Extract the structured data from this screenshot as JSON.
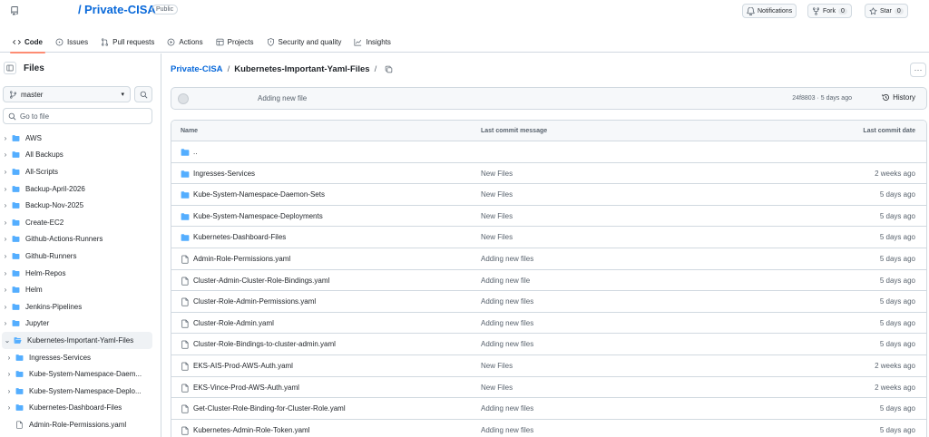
{
  "header": {
    "repo_name": "Private-CISA",
    "repo_slash": "/",
    "visibility": "Public",
    "notifications_label": "Notifications",
    "fork_label": "Fork",
    "fork_count": "0",
    "star_label": "Star",
    "star_count": "0"
  },
  "tabs": [
    {
      "label": "Code",
      "icon": "code-icon"
    },
    {
      "label": "Issues",
      "icon": "issue-icon"
    },
    {
      "label": "Pull requests",
      "icon": "pull-request-icon"
    },
    {
      "label": "Actions",
      "icon": "play-icon"
    },
    {
      "label": "Projects",
      "icon": "table-icon"
    },
    {
      "label": "Security and quality",
      "icon": "shield-icon"
    },
    {
      "label": "Insights",
      "icon": "graph-icon"
    }
  ],
  "sidebar": {
    "title": "Files",
    "branch": "master",
    "goto_placeholder": "Go to file",
    "items": [
      {
        "label": "AWS",
        "type": "folder"
      },
      {
        "label": "All Backups",
        "type": "folder"
      },
      {
        "label": "All-Scripts",
        "type": "folder"
      },
      {
        "label": "Backup-April-2026",
        "type": "folder"
      },
      {
        "label": "Backup-Nov-2025",
        "type": "folder"
      },
      {
        "label": "Create-EC2",
        "type": "folder"
      },
      {
        "label": "Github-Actions-Runners",
        "type": "folder"
      },
      {
        "label": "Github-Runners",
        "type": "folder"
      },
      {
        "label": "Helm-Repos",
        "type": "folder"
      },
      {
        "label": "Helm",
        "type": "folder"
      },
      {
        "label": "Jenkins-Pipelines",
        "type": "folder"
      },
      {
        "label": "Jupyter",
        "type": "folder"
      },
      {
        "label": "Kubernetes-Important-Yaml-Files",
        "type": "folder-open"
      },
      {
        "label": "Ingresses-Services",
        "type": "folder"
      },
      {
        "label": "Kube-System-Namespace-Daem...",
        "type": "folder"
      },
      {
        "label": "Kube-System-Namespace-Deplo...",
        "type": "folder"
      },
      {
        "label": "Kubernetes-Dashboard-Files",
        "type": "folder"
      },
      {
        "label": "Admin-Role-Permissions.yaml",
        "type": "file"
      }
    ]
  },
  "main": {
    "breadcrumb_repo": "Private-CISA",
    "breadcrumb_sep": "/",
    "breadcrumb_folder": "Kubernetes-Important-Yaml-Files",
    "breadcrumb_trail": "/",
    "more_label": "···",
    "commit_message": "Adding new file",
    "commit_meta": "24f8803 · 5 days ago",
    "history_label": "History",
    "columns": {
      "name": "Name",
      "message": "Last commit message",
      "date": "Last commit date"
    },
    "rows": [
      {
        "name": "..",
        "type": "folder",
        "message": "",
        "date": ""
      },
      {
        "name": "Ingresses-Services",
        "type": "folder",
        "message": "New Files",
        "date": "2 weeks ago"
      },
      {
        "name": "Kube-System-Namespace-Daemon-Sets",
        "type": "folder",
        "message": "New Files",
        "date": "5 days ago"
      },
      {
        "name": "Kube-System-Namespace-Deployments",
        "type": "folder",
        "message": "New Files",
        "date": "5 days ago"
      },
      {
        "name": "Kubernetes-Dashboard-Files",
        "type": "folder",
        "message": "New Files",
        "date": "5 days ago"
      },
      {
        "name": "Admin-Role-Permissions.yaml",
        "type": "file",
        "message": "Adding new files",
        "date": "5 days ago"
      },
      {
        "name": "Cluster-Admin-Cluster-Role-Bindings.yaml",
        "type": "file",
        "message": "Adding new file",
        "date": "5 days ago"
      },
      {
        "name": "Cluster-Role-Admin-Permissions.yaml",
        "type": "file",
        "message": "Adding new files",
        "date": "5 days ago"
      },
      {
        "name": "Cluster-Role-Admin.yaml",
        "type": "file",
        "message": "Adding new files",
        "date": "5 days ago"
      },
      {
        "name": "Cluster-Role-Bindings-to-cluster-admin.yaml",
        "type": "file",
        "message": "Adding new files",
        "date": "5 days ago"
      },
      {
        "name": "EKS-AIS-Prod-AWS-Auth.yaml",
        "type": "file",
        "message": "New Files",
        "date": "2 weeks ago"
      },
      {
        "name": "EKS-Vince-Prod-AWS-Auth.yaml",
        "type": "file",
        "message": "New Files",
        "date": "2 weeks ago"
      },
      {
        "name": "Get-Cluster-Role-Binding-for-Cluster-Role.yaml",
        "type": "file",
        "message": "Adding new files",
        "date": "5 days ago"
      },
      {
        "name": "Kubernetes-Admin-Role-Token.yaml",
        "type": "file",
        "message": "Adding new files",
        "date": "5 days ago"
      }
    ]
  },
  "colors": {
    "accent_link": "#0969da",
    "folder": "#54aeff",
    "border": "#d1d9e0",
    "tab_underline": "#fd8c73"
  }
}
